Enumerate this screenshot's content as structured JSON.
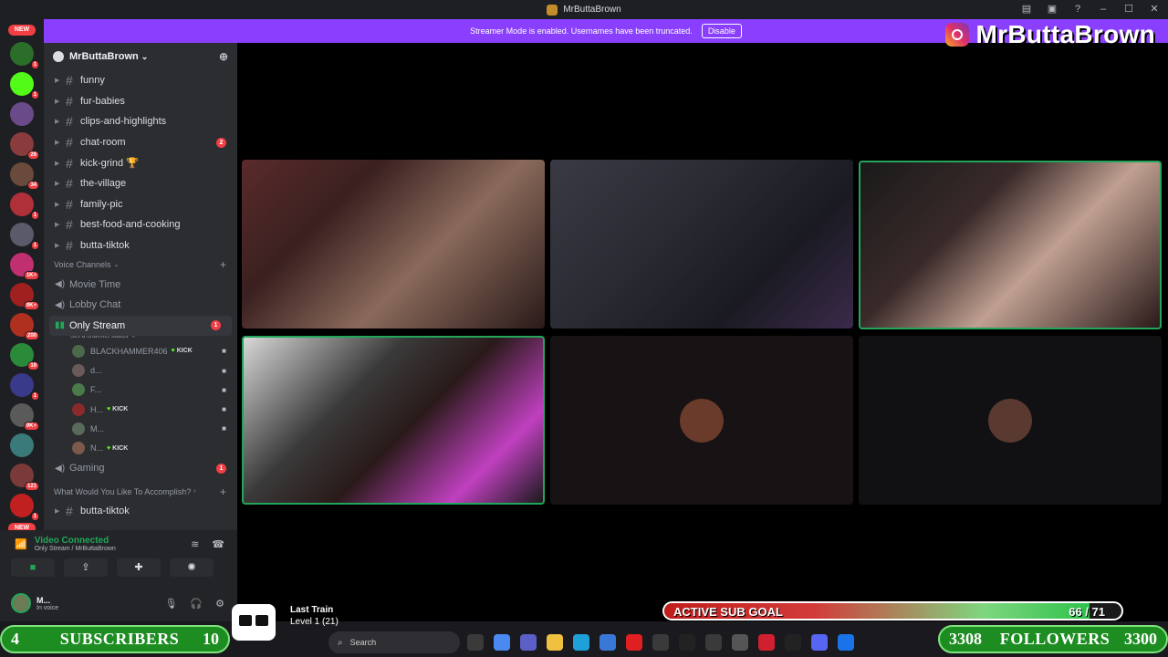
{
  "window": {
    "title": "MrButtaBrown",
    "controls": [
      "–",
      "☐",
      "✕"
    ],
    "toolbar_icons": [
      "inbox-icon",
      "screen-icon",
      "help-icon"
    ]
  },
  "streamer_banner": {
    "text": "Streamer Mode is enabled. Usernames have been truncated.",
    "disable_label": "Disable"
  },
  "overlay": {
    "instagram_handle": "MrButtaBrown"
  },
  "rail": {
    "new_label": "NEW",
    "servers": [
      {
        "color": "#2a6e2a",
        "badge": "1"
      },
      {
        "color": "#53fc18",
        "badge": "1"
      },
      {
        "color": "#6b4a8a",
        "badge": ""
      },
      {
        "color": "#8a3b3b",
        "badge": "29"
      },
      {
        "color": "#6a4a3a",
        "badge": "34"
      },
      {
        "color": "#b0303a",
        "badge": "1"
      },
      {
        "color": "#5a5a6a",
        "badge": "1"
      },
      {
        "color": "#c03070",
        "badge": "1K+"
      },
      {
        "color": "#a02020",
        "badge": "9K+"
      },
      {
        "color": "#b03020",
        "badge": "200"
      },
      {
        "color": "#2a8a3a",
        "badge": "19"
      },
      {
        "color": "#3a3a8a",
        "badge": "1"
      },
      {
        "color": "#5a5a5a",
        "badge": "9K+"
      },
      {
        "color": "#3a7a7a",
        "badge": ""
      },
      {
        "color": "#7a3a3a",
        "badge": "121"
      },
      {
        "color": "#c02020",
        "badge": "1"
      }
    ],
    "new_bottom_label": "NEW"
  },
  "sidebar": {
    "server_name": "MrButtaBrown",
    "channels": [
      {
        "name": "funny",
        "mention": ""
      },
      {
        "name": "fur-babies",
        "mention": ""
      },
      {
        "name": "clips-and-highlights",
        "mention": ""
      },
      {
        "name": "chat-room",
        "mention": "2"
      },
      {
        "name": "kick-grind 🏆",
        "mention": ""
      },
      {
        "name": "the-village",
        "mention": ""
      },
      {
        "name": "family-pic",
        "mention": ""
      },
      {
        "name": "best-food-and-cooking",
        "mention": ""
      },
      {
        "name": "butta-tiktok",
        "mention": ""
      }
    ],
    "voice_category": "Voice Channels",
    "voice_channels": [
      {
        "name": "Movie Time",
        "mention": ""
      },
      {
        "name": "Lobby Chat",
        "mention": ""
      }
    ],
    "active_voice": {
      "name": "Only Stream",
      "mention": "1",
      "status": "Set a channel status"
    },
    "voice_users": [
      {
        "name": "BLACKHAMMER406",
        "kick": "KICK",
        "color": "#4a6a4a",
        "cam": true
      },
      {
        "name": "d...",
        "kick": "",
        "color": "#6a5a5a",
        "cam": true
      },
      {
        "name": "F...",
        "kick": "",
        "color": "#4a7a4a",
        "cam": true
      },
      {
        "name": "H...",
        "kick": "KICK",
        "color": "#8a2a2a",
        "cam": true
      },
      {
        "name": "M...",
        "kick": "",
        "color": "#5a6a5a",
        "cam": true
      },
      {
        "name": "N...",
        "kick": "KICK",
        "color": "#7a5a4a",
        "cam": false
      }
    ],
    "gaming": {
      "name": "Gaming",
      "mention": "1"
    },
    "accomplish_category": "What Would You Like To Accomplish?",
    "last_channel": "butta-tiktok"
  },
  "voice_panel": {
    "title": "Video Connected",
    "subtitle": "Only Stream / MrButtaBrown"
  },
  "user_panel": {
    "name": "M...",
    "status": "In voice"
  },
  "tiles": [
    {
      "type": "video",
      "speaking": false,
      "bg": "linear-gradient(135deg,#5a2a2a 0%,#3a2020 30%,#8a6a5a 60%,#2a1a1a 100%)"
    },
    {
      "type": "video",
      "speaking": false,
      "bg": "linear-gradient(135deg,#3a3a44 0%,#2a2a33 40%,#1a1a22 70%,#3a2a4a 100%)"
    },
    {
      "type": "video",
      "speaking": true,
      "bg": "linear-gradient(135deg,#1a1a1a 0%,#3a2a2a 35%,#c0a090 60%,#2a1a1a 100%)"
    },
    {
      "type": "video",
      "speaking": true,
      "bg": "linear-gradient(135deg,#d8d8d8 0%,#3a3a3a 35%,#2a1a1a 55%,#c040c0 80%,#1a1a1a 100%)"
    },
    {
      "type": "avatar",
      "speaking": false,
      "avatar_color": "#6a3a2a"
    },
    {
      "type": "avatar",
      "speaking": false,
      "avatar_color": "#5a3a30"
    }
  ],
  "sub_goal": {
    "label": "ACTIVE SUB GOAL",
    "current": 66,
    "target": 71,
    "count_text": "66 / 71"
  },
  "subscribers_bar": {
    "left": "4",
    "label": "SUBSCRIBERS",
    "right": "10"
  },
  "followers_bar": {
    "left": "3308",
    "label": "FOLLOWERS",
    "right": "3300"
  },
  "music": {
    "title": "Last Train",
    "subtitle": "Level 1  (21)"
  },
  "taskbar": {
    "search_placeholder": "Search",
    "icons": [
      {
        "name": "task-view-icon",
        "color": "#3a3a3a"
      },
      {
        "name": "copilot-icon",
        "color": "#4a8af0"
      },
      {
        "name": "teams-icon",
        "color": "#5b5fc7"
      },
      {
        "name": "file-explorer-icon",
        "color": "#f0c040"
      },
      {
        "name": "edge-icon",
        "color": "#1ea0d8"
      },
      {
        "name": "store-icon",
        "color": "#3a78d8"
      },
      {
        "name": "youtube-icon",
        "color": "#e02020"
      },
      {
        "name": "xbox-icon",
        "color": "#3a3a3a"
      },
      {
        "name": "tiktok-icon",
        "color": "#222"
      },
      {
        "name": "obs-icon",
        "color": "#3a3a3a"
      },
      {
        "name": "app-icon",
        "color": "#555"
      },
      {
        "name": "streamlabs-icon",
        "color": "#d02030"
      },
      {
        "name": "capcut-icon",
        "color": "#222"
      },
      {
        "name": "discord-icon",
        "color": "#5865f2"
      },
      {
        "name": "chrome-icon",
        "color": "#1a73e8"
      }
    ]
  }
}
